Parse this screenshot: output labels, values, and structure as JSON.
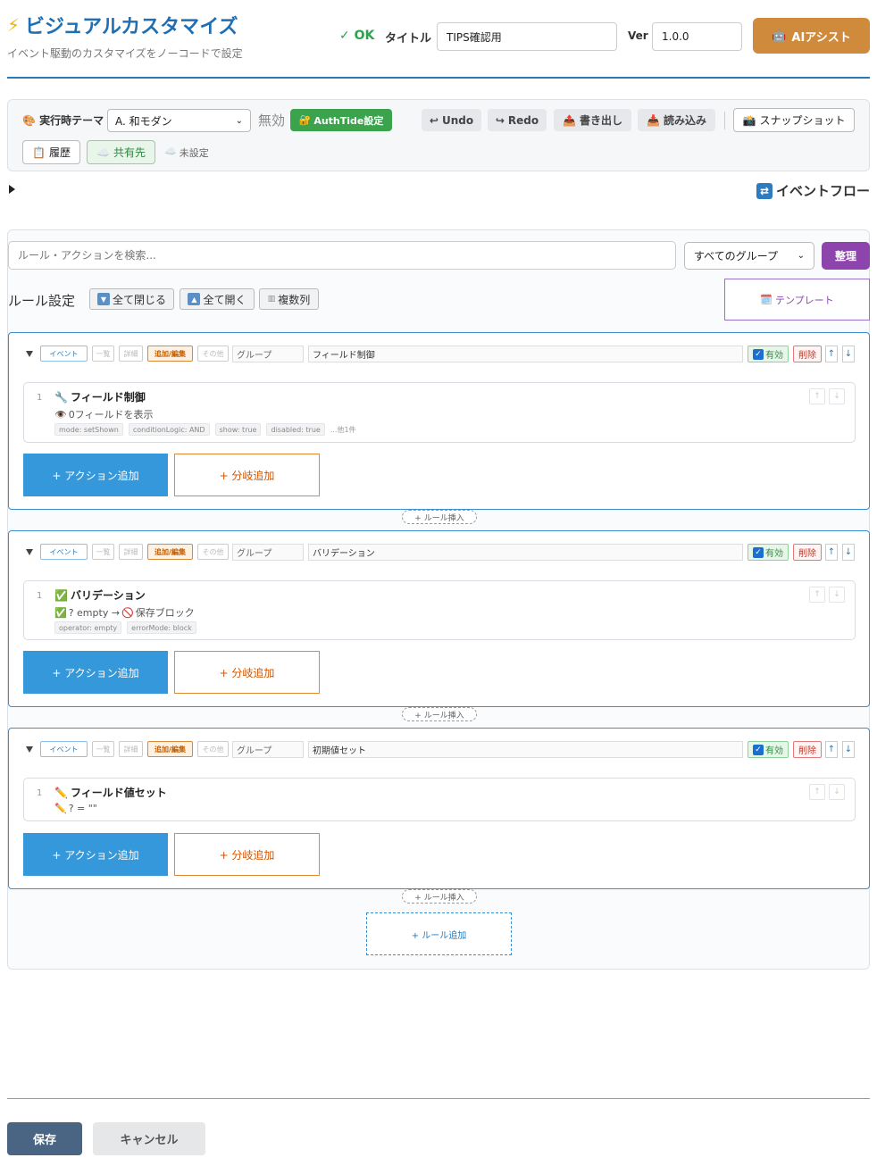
{
  "header": {
    "title": "ビジュアルカスタマイズ",
    "subtitle": "イベント駆動のカスタマイズをノーコードで設定",
    "status": "✓ OK",
    "title_label": "タイトル",
    "title_value": "TIPS確認用",
    "ver_label": "Ver",
    "ver_value": "1.0.0",
    "ai_button": "AIアシスト"
  },
  "toolbar": {
    "theme_label": "実行時テーマ",
    "theme_value": "A. 和モダン",
    "disabled_text": "無効",
    "auth_button": "AuthTide設定",
    "undo": "Undo",
    "redo": "Redo",
    "export": "書き出し",
    "import": "読み込み",
    "snapshot": "スナップショット",
    "history": "履歴",
    "share": "共有先",
    "unset": "未設定"
  },
  "event_flow": {
    "title": "イベントフロー"
  },
  "rules_panel": {
    "search_placeholder": "ルール・アクションを検索...",
    "group_filter": "すべてのグループ",
    "tidy_button": "整理",
    "heading": "ルール設定",
    "collapse_all": "全て閉じる",
    "expand_all": "全て開く",
    "multi_column": "複数列",
    "template_button": "テンプレート",
    "chips": {
      "event": "イベント",
      "list": "一覧",
      "detail": "詳細",
      "add_edit": "追加/編集",
      "other": "その他"
    },
    "group_placeholder": "グループ",
    "enabled_label": "有効",
    "delete_label": "削除",
    "up": "↑",
    "down": "↓",
    "add_action": "+ アクション追加",
    "add_branch": "+ 分岐追加",
    "insert_rule": "+ ルール挿入",
    "add_rule": "+ ルール追加",
    "rules": [
      {
        "name": "フィールド制御",
        "action": {
          "num": "1",
          "title": "フィールド制御",
          "desc": "0フィールドを表示",
          "tags": [
            "mode: setShown",
            "conditionLogic: AND",
            "show: true",
            "disabled: true"
          ],
          "more": "...他1件"
        }
      },
      {
        "name": "バリデーション",
        "action": {
          "num": "1",
          "title": "バリデーション",
          "desc_a": "? empty →",
          "desc_b": "保存ブロック",
          "tags": [
            "operator: empty",
            "errorMode: block"
          ]
        }
      },
      {
        "name": "初期値セット",
        "action": {
          "num": "1",
          "title": "フィールド値セット",
          "desc": "? = \"\""
        }
      }
    ]
  },
  "footer": {
    "save": "保存",
    "cancel": "キャンセル"
  },
  "colors": {
    "primary": "#1f6fb2",
    "accent_orange": "#d08a3c",
    "green": "#3ba34c",
    "purple": "#8e44ad",
    "action_blue": "#3498db"
  }
}
